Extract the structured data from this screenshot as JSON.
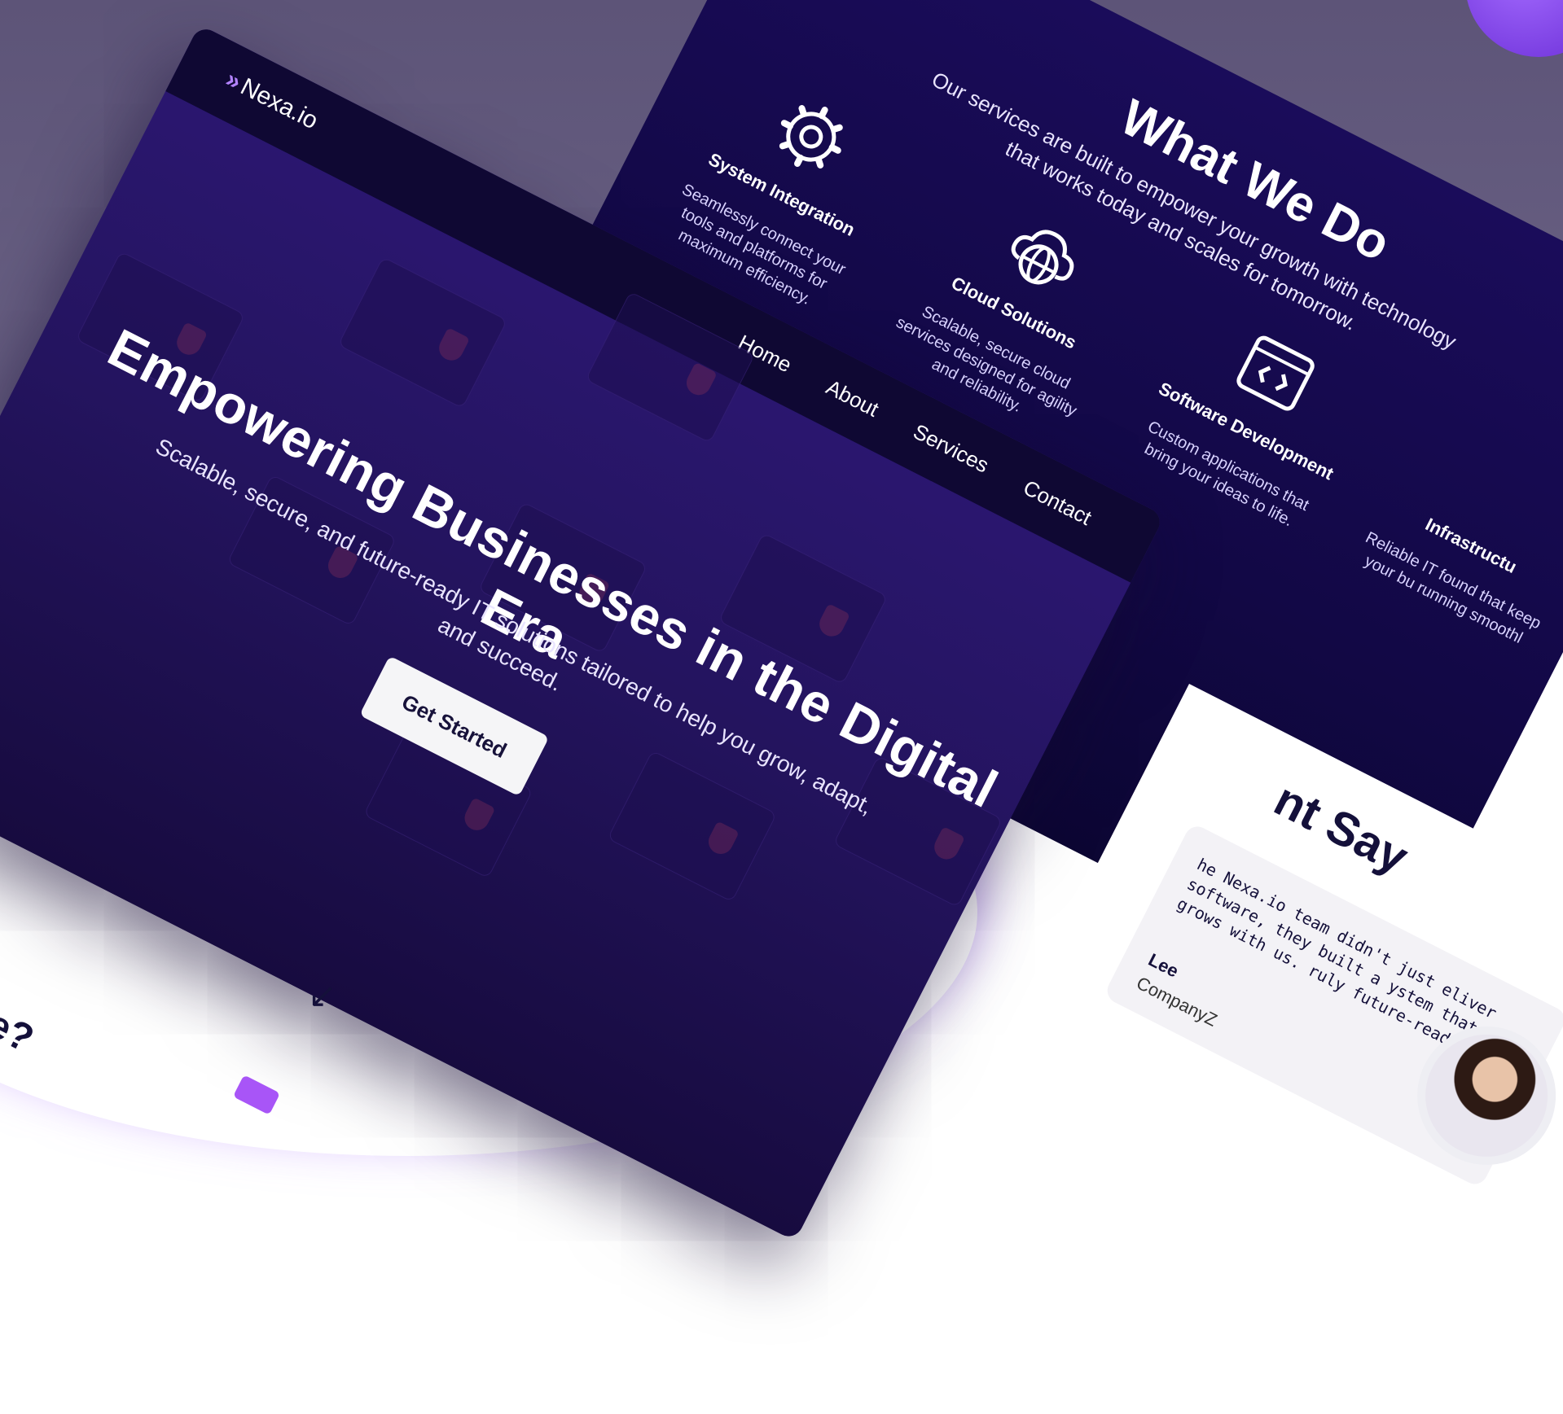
{
  "brand": {
    "name": "Nexa.io",
    "logo_icon": "chevrons-icon",
    "accent": "#b383ff"
  },
  "nav": {
    "items": [
      "Home",
      "About",
      "Services",
      "Contact"
    ]
  },
  "hero": {
    "title": "Empowering Businesses in the Digital Era",
    "subtitle": "Scalable, secure, and future-ready IT solutions tailored to help you grow, adapt, and succeed.",
    "cta_label": "Get Started"
  },
  "services": {
    "title": "What We Do",
    "subtitle": "Our services are built to empower your growth with technology that works today and scales for tomorrow.",
    "cards": [
      {
        "icon": "gear-icon",
        "title": "System Integration",
        "text": "Seamlessly connect your tools and platforms for maximum efficiency."
      },
      {
        "icon": "cloud-globe-icon",
        "title": "Cloud Solutions",
        "text": "Scalable, secure cloud services designed for agility and reliability."
      },
      {
        "icon": "code-window-icon",
        "title": "Software Development",
        "text": "Custom applications that bring your ideas to life."
      },
      {
        "icon": "infrastructure-icon",
        "title": "Infrastructu",
        "text": "Reliable IT found that keep your bu running smoothl"
      }
    ]
  },
  "testimonials": {
    "title": "nt Say",
    "quote": "he Nexa.io team didn't just eliver software, they built a ystem that grows with us. ruly future-ready.",
    "name": "Lee",
    "company": "CompanyZ"
  },
  "fragments": {
    "heading": "e?",
    "arrow": "↙"
  }
}
